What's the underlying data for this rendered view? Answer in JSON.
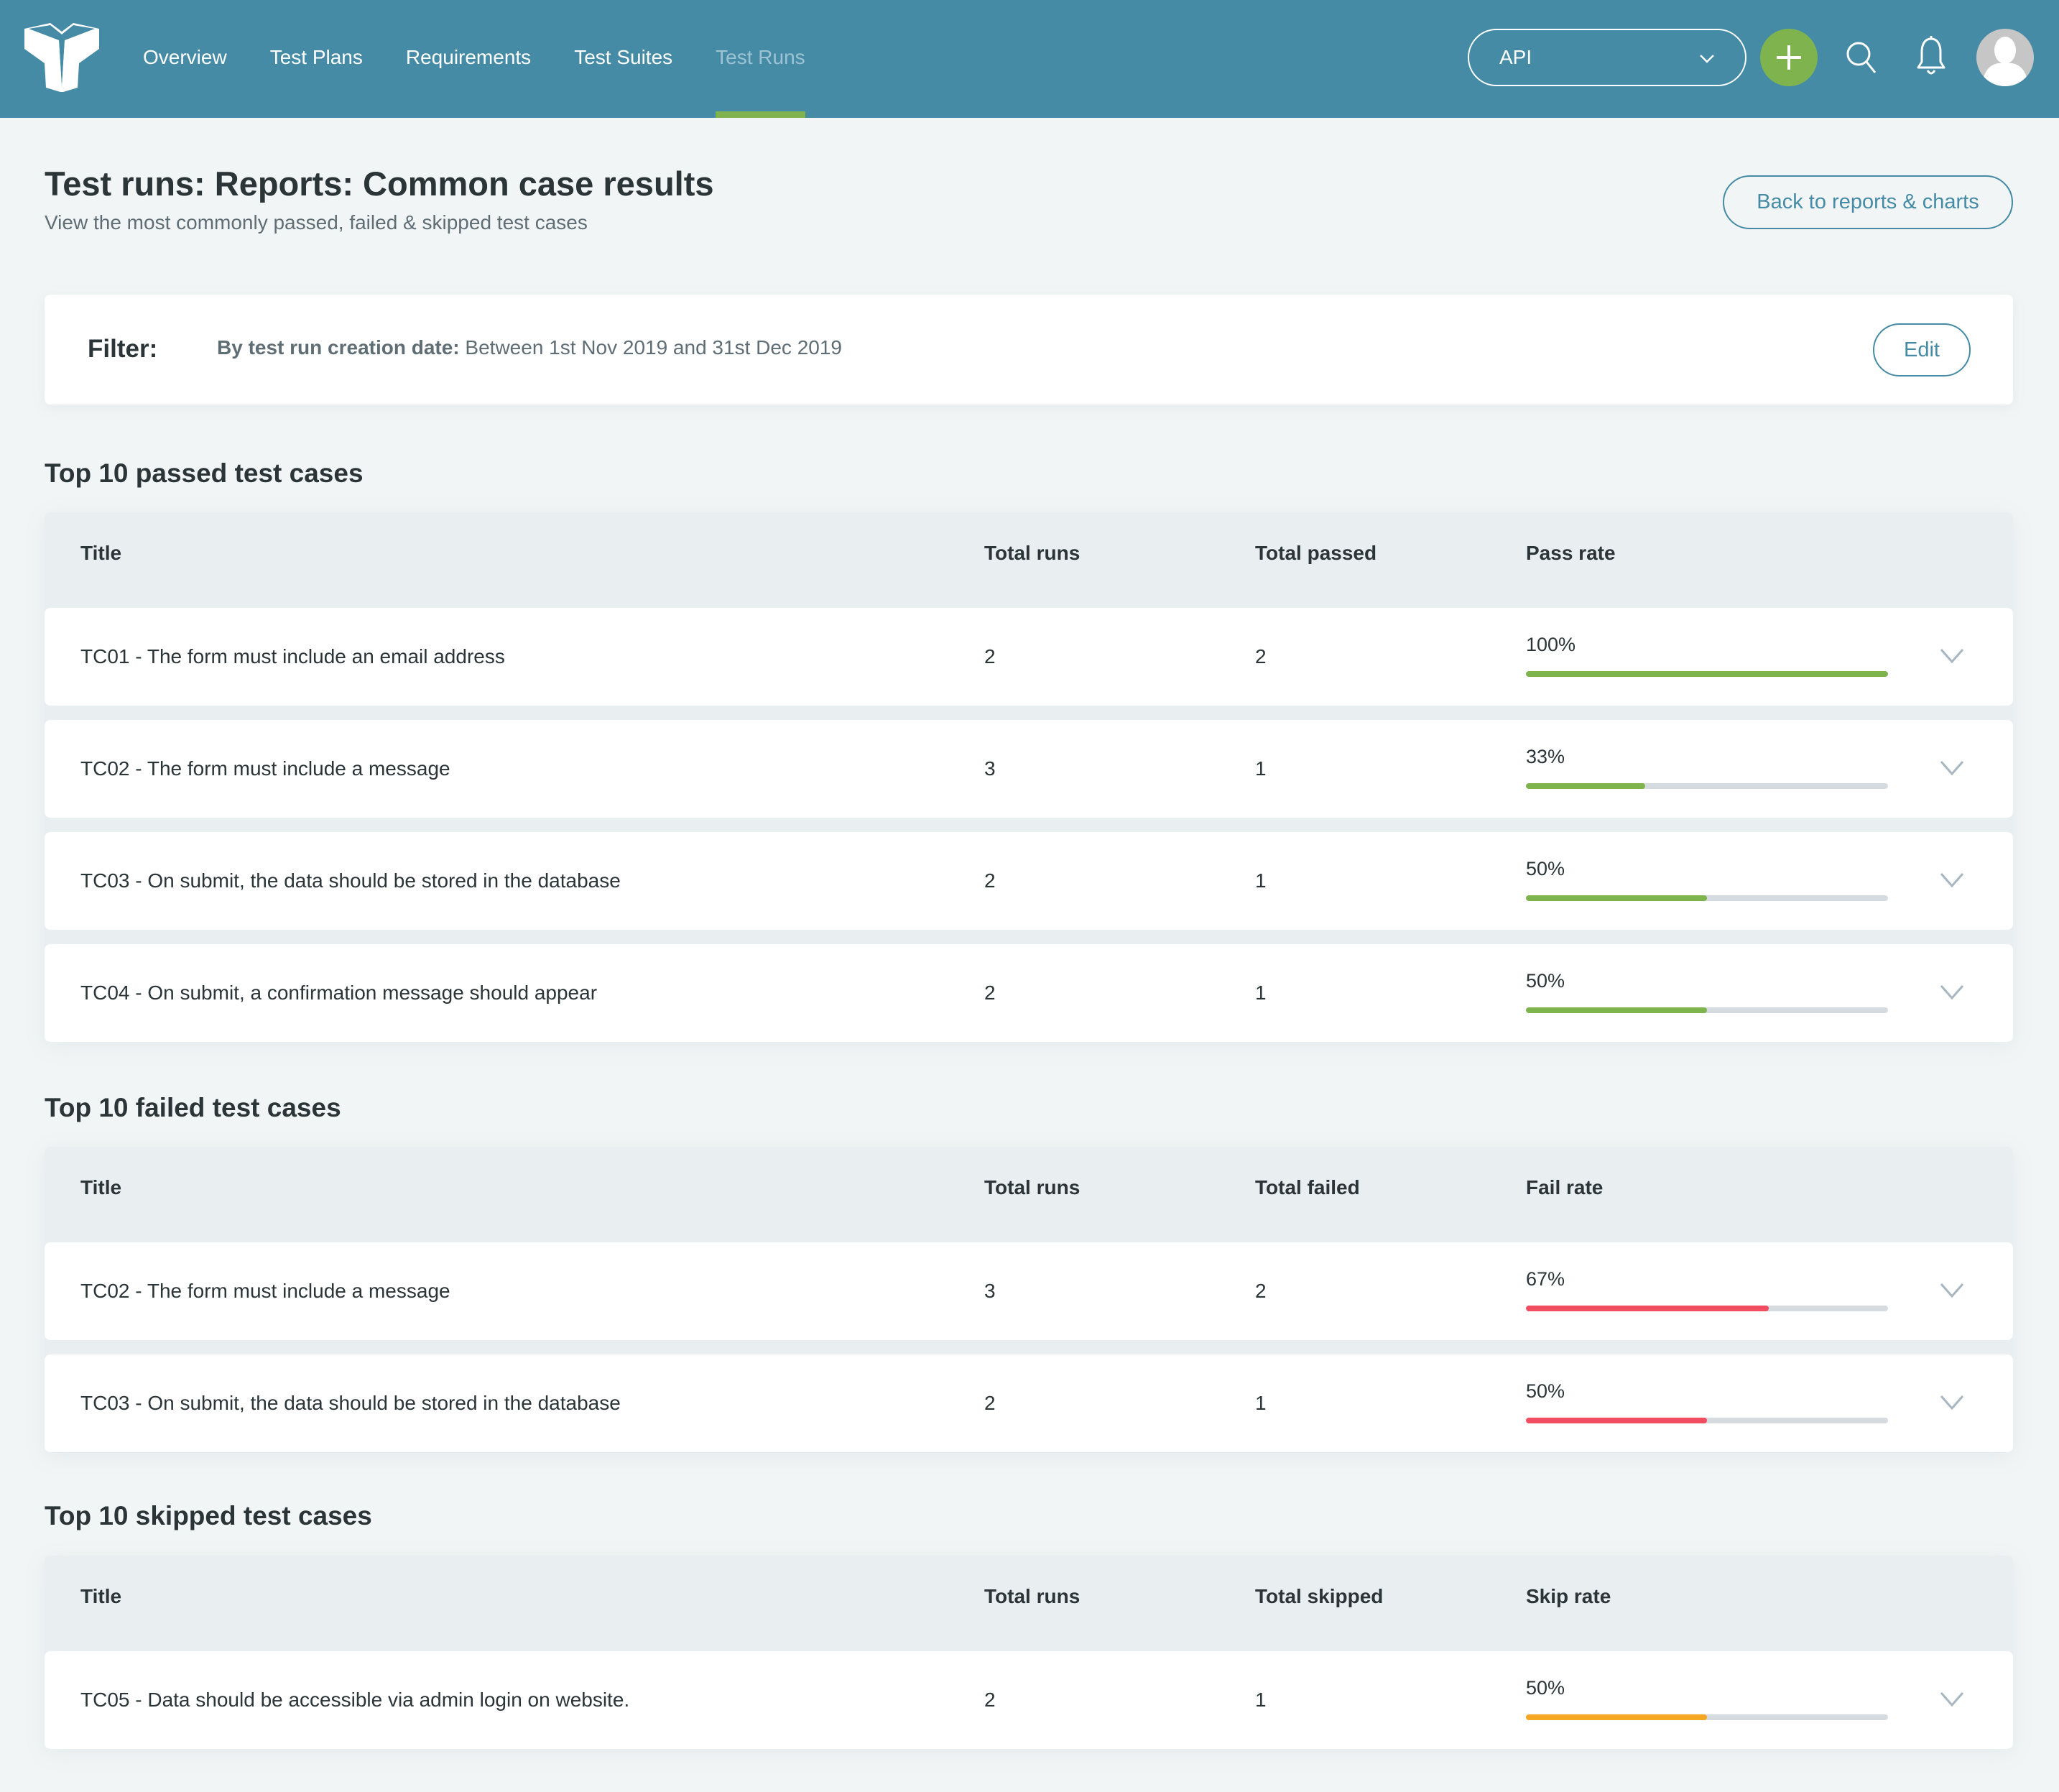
{
  "nav": {
    "items": [
      {
        "label": "Overview",
        "active": false
      },
      {
        "label": "Test Plans",
        "active": false
      },
      {
        "label": "Requirements",
        "active": false
      },
      {
        "label": "Test Suites",
        "active": false
      },
      {
        "label": "Test Runs",
        "active": true
      }
    ],
    "project_select": {
      "value": "API",
      "icon": "chevron-down-icon"
    },
    "add_button": {
      "icon": "plus-icon"
    },
    "search_button": {
      "icon": "search-icon"
    },
    "notifications_button": {
      "icon": "bell-icon"
    },
    "avatar": {
      "icon": "user-avatar-icon"
    }
  },
  "page": {
    "title": "Test runs: Reports: Common case results",
    "subtitle": "View the most commonly passed, failed & skipped test cases",
    "back_button": "Back to reports & charts"
  },
  "filter": {
    "label": "Filter:",
    "criterion_label": "By test run creation date:",
    "criterion_value": " Between 1st Nov 2019 and 31st Dec 2019",
    "edit_button": "Edit"
  },
  "colors": {
    "header_bg": "#458ba6",
    "accent": "#458ba6",
    "pass": "#7fb34d",
    "fail": "#f24c60",
    "skip": "#f5a623",
    "track": "#d6dbdf"
  },
  "sections": [
    {
      "title": "Top 10 passed test cases",
      "columns": [
        "Title",
        "Total runs",
        "Total passed",
        "Pass rate"
      ],
      "bar_color": "#7fb34d",
      "rows": [
        {
          "title": "TC01 - The form must include an email address",
          "total_runs": "2",
          "total": "2",
          "rate_label": "100%",
          "rate": 100
        },
        {
          "title": "TC02 - The form must include a message",
          "total_runs": "3",
          "total": "1",
          "rate_label": "33%",
          "rate": 33
        },
        {
          "title": "TC03 - On submit, the data should be stored in the database",
          "total_runs": "2",
          "total": "1",
          "rate_label": "50%",
          "rate": 50
        },
        {
          "title": "TC04 - On submit, a confirmation message should appear",
          "total_runs": "2",
          "total": "1",
          "rate_label": "50%",
          "rate": 50
        }
      ]
    },
    {
      "title": "Top 10 failed test cases",
      "columns": [
        "Title",
        "Total runs",
        "Total failed",
        "Fail rate"
      ],
      "bar_color": "#f24c60",
      "rows": [
        {
          "title": "TC02 - The form must include a message",
          "total_runs": "3",
          "total": "2",
          "rate_label": "67%",
          "rate": 67
        },
        {
          "title": "TC03 - On submit, the data should be stored in the database",
          "total_runs": "2",
          "total": "1",
          "rate_label": "50%",
          "rate": 50
        }
      ]
    },
    {
      "title": "Top 10 skipped test cases",
      "columns": [
        "Title",
        "Total runs",
        "Total skipped",
        "Skip rate"
      ],
      "bar_color": "#f5a623",
      "rows": [
        {
          "title": "TC05 - Data should be accessible via admin login on website.",
          "total_runs": "2",
          "total": "1",
          "rate_label": "50%",
          "rate": 50
        }
      ]
    }
  ]
}
